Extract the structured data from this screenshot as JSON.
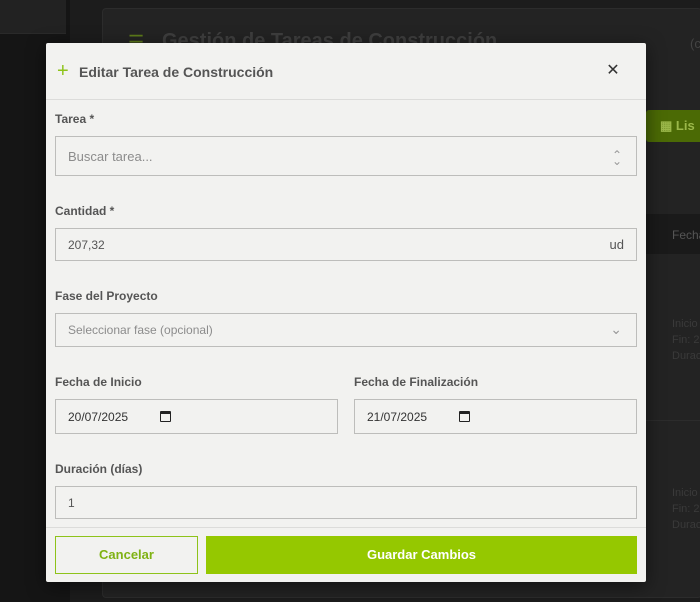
{
  "background": {
    "title": "Gestión de Tareas de Construcción",
    "top_right_text": "(c",
    "list_button_label": "Lis",
    "table_header": "Fecha",
    "rows": [
      [
        "Inicio",
        "Fin: 2",
        "Durac"
      ],
      [
        "Inicio",
        "Fin: 2",
        "Durac"
      ]
    ]
  },
  "modal": {
    "title": "Editar Tarea de Construcción",
    "close_icon": "close-icon",
    "add_icon": "plus-icon",
    "fields": {
      "tarea": {
        "label": "Tarea *",
        "placeholder": "Buscar tarea..."
      },
      "cantidad": {
        "label": "Cantidad *",
        "value": "207,32",
        "unit": "ud"
      },
      "fase": {
        "label": "Fase del Proyecto",
        "placeholder": "Seleccionar fase (opcional)"
      },
      "fecha_inicio": {
        "label": "Fecha de Inicio",
        "value": "20/07/2025"
      },
      "fecha_fin": {
        "label": "Fecha de Finalización",
        "value": "21/07/2025"
      },
      "duracion": {
        "label": "Duración (días)",
        "value": "1"
      }
    },
    "buttons": {
      "cancel": "Cancelar",
      "save": "Guardar Cambios"
    }
  },
  "colors": {
    "accent": "#95c800",
    "overlay": "#1e1e1e",
    "modal_bg": "#f2f2f0"
  }
}
